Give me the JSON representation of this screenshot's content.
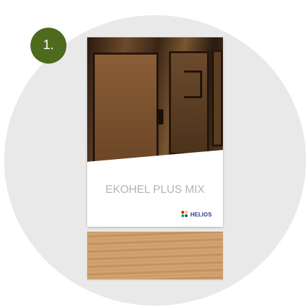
{
  "step": {
    "number": "1."
  },
  "brochure": {
    "title": "EKOHEL PLUS MIX",
    "brand": "HELIOS"
  },
  "colors": {
    "badge": "#4e6a1d",
    "background_circle": "#e9e9e9",
    "swatch": "#cf9f6c"
  },
  "icons": {
    "logo": "helios-logo-icon"
  }
}
